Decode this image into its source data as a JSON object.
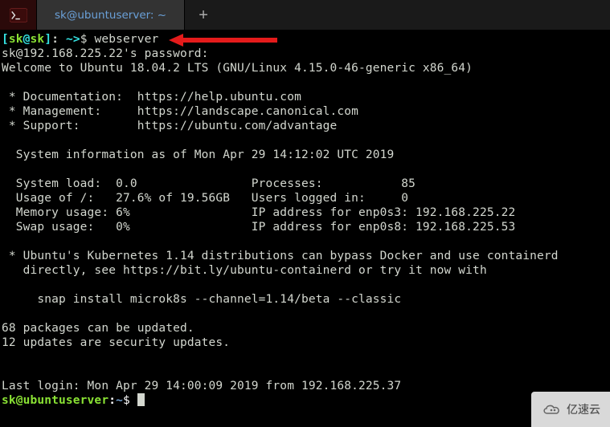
{
  "tabbar": {
    "active_tab_title": "sk@ubuntuserver: ~",
    "add_tab_glyph": "+"
  },
  "prompt1": {
    "lbracket": "[",
    "user": "sk",
    "at": "@",
    "host": "sk",
    "rbracket": "]",
    "sep": ": ",
    "path": "~>",
    "dollar": "$ ",
    "command": "webserver"
  },
  "body": {
    "line_pw": "sk@192.168.225.22's password:",
    "line_welcome": "Welcome to Ubuntu 18.04.2 LTS (GNU/Linux 4.15.0-46-generic x86_64)",
    "line_blank": "",
    "line_doc": " * Documentation:  https://help.ubuntu.com",
    "line_mgmt": " * Management:     https://landscape.canonical.com",
    "line_supp": " * Support:        https://ubuntu.com/advantage",
    "line_sysinfo_hdr": "  System information as of Mon Apr 29 14:12:02 UTC 2019",
    "line_s1": "  System load:  0.0                Processes:           85",
    "line_s2": "  Usage of /:   27.6% of 19.56GB   Users logged in:     0",
    "line_s3": "  Memory usage: 6%                 IP address for enp0s3: 192.168.225.22",
    "line_s4": "  Swap usage:   0%                 IP address for enp0s8: 192.168.225.53",
    "line_k1": " * Ubuntu's Kubernetes 1.14 distributions can bypass Docker and use containerd",
    "line_k2": "   directly, see https://bit.ly/ubuntu-containerd or try it now with",
    "line_k3": "     snap install microk8s --channel=1.14/beta --classic",
    "line_upd1": "68 packages can be updated.",
    "line_upd2": "12 updates are security updates.",
    "line_lastlogin": "Last login: Mon Apr 29 14:00:09 2019 from 192.168.225.37"
  },
  "prompt2": {
    "user_host": "sk@ubuntuserver",
    "colon": ":",
    "path": "~",
    "dollar": "$ "
  },
  "watermark": {
    "text": "亿速云"
  }
}
